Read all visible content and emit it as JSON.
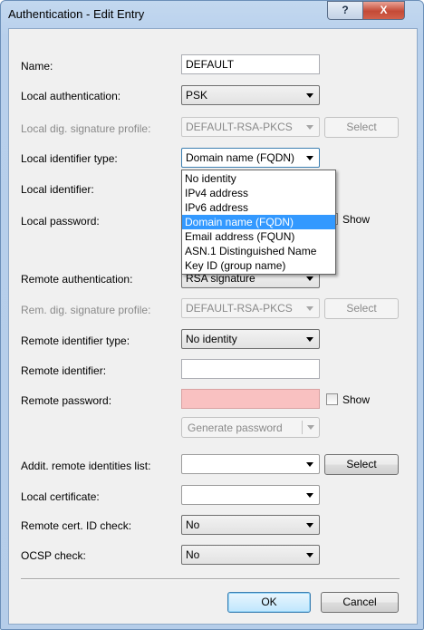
{
  "window": {
    "title": "Authentication - Edit Entry",
    "help_glyph": "?",
    "close_glyph": "X"
  },
  "form": {
    "name": {
      "label": "Name:",
      "value": "DEFAULT"
    },
    "local_auth": {
      "label": "Local authentication:",
      "value": "PSK"
    },
    "local_sig_profile": {
      "label": "Local dig. signature profile:",
      "value": "DEFAULT-RSA-PKCS",
      "button": "Select"
    },
    "local_id_type": {
      "label": "Local identifier type:",
      "value": "Domain name (FQDN)"
    },
    "local_id": {
      "label": "Local identifier:"
    },
    "local_password": {
      "label": "Local password:",
      "show_label": "Show"
    },
    "remote_auth": {
      "label": "Remote authentication:",
      "value": "RSA signature"
    },
    "rem_sig_profile": {
      "label": "Rem. dig. signature profile:",
      "value": "DEFAULT-RSA-PKCS",
      "button": "Select"
    },
    "remote_id_type": {
      "label": "Remote identifier type:",
      "value": "No identity"
    },
    "remote_id": {
      "label": "Remote identifier:",
      "value": ""
    },
    "remote_password": {
      "label": "Remote password:",
      "value": "",
      "show_label": "Show",
      "generate_label": "Generate password"
    },
    "addit_remote": {
      "label": "Addit. remote identities list:",
      "value": "",
      "button": "Select"
    },
    "local_cert": {
      "label": "Local certificate:",
      "value": ""
    },
    "remote_cert_check": {
      "label": "Remote cert. ID check:",
      "value": "No"
    },
    "ocsp_check": {
      "label": "OCSP check:",
      "value": "No"
    }
  },
  "dropdown": {
    "options": [
      "No identity",
      "IPv4 address",
      "IPv6 address",
      "Domain name (FQDN)",
      "Email address (FQUN)",
      "ASN.1 Distinguished Name",
      "Key ID (group name)"
    ],
    "selected_index": 3
  },
  "buttons": {
    "ok": "OK",
    "cancel": "Cancel"
  },
  "colors": {
    "accent": "#3399ff",
    "error_field": "#f9c1c1",
    "close": "#c44a36"
  }
}
